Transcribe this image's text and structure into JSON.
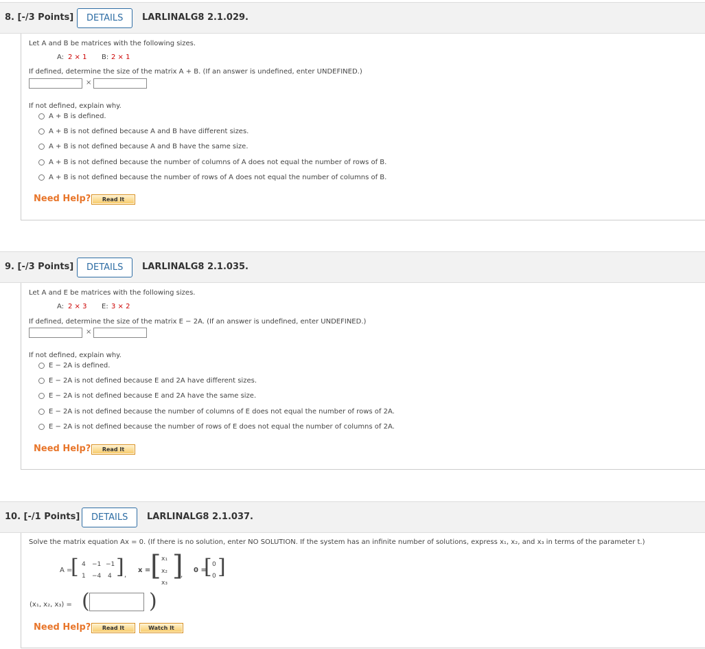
{
  "q8": {
    "points": "8.  [-/3 Points]",
    "details": "DETAILS",
    "code": "LARLINALG8 2.1.029.",
    "intro": "Let A and B be matrices with the following sizes.",
    "sizeA_label": "A:",
    "sizeA": "2 × 1",
    "sizeB_label": "B:",
    "sizeB": "2 × 1",
    "prompt": "If defined, determine the size of the matrix A + B. (If an answer is undefined, enter UNDEFINED.)",
    "times": "×",
    "explain": "If not defined, explain why.",
    "options": [
      "A + B is defined.",
      "A + B is not defined because A and B have different sizes.",
      "A + B is not defined because A and B have the same size.",
      "A + B is not defined because the number of columns of A does not equal the number of rows of B.",
      "A + B is not defined because the number of rows of A does not equal the number of columns of B."
    ],
    "help": "Need Help?",
    "read": "Read It"
  },
  "q9": {
    "points": "9.  [-/3 Points]",
    "details": "DETAILS",
    "code": "LARLINALG8 2.1.035.",
    "intro": "Let A and E be matrices with the following sizes.",
    "sizeA_label": "A:",
    "sizeA": "2 × 3",
    "sizeB_label": "E:",
    "sizeB": "3 × 2",
    "prompt": "If defined, determine the size of the matrix E − 2A. (If an answer is undefined, enter UNDEFINED.)",
    "times": "×",
    "explain": "If not defined, explain why.",
    "options": [
      "E − 2A is defined.",
      "E − 2A is not defined because E and 2A have different sizes.",
      "E − 2A is not defined because E and 2A have the same size.",
      "E − 2A is not defined because the number of columns of E does not equal the number of rows of 2A.",
      "E − 2A is not defined because the number of rows of E does not equal the number of columns of 2A."
    ],
    "help": "Need Help?",
    "read": "Read It"
  },
  "q10": {
    "points": "10.  [-/1 Points]",
    "details": "DETAILS",
    "code": "LARLINALG8 2.1.037.",
    "prompt": "Solve the matrix equation Ax = 0. (If there is no solution, enter NO SOLUTION. If the system has an infinite number of solutions, express x₁, x₂, and x₃ in terms of the parameter t.)",
    "A_label": "A =",
    "A_row1": [
      "4",
      "−1",
      "−1"
    ],
    "A_row2": [
      "1",
      "−4",
      "4"
    ],
    "x_label": "x =",
    "x_entries": [
      "x₁",
      "x₂",
      "x₃"
    ],
    "zero_label": "0 =",
    "zero_entries": [
      "0",
      "0"
    ],
    "tuple_label": "(x₁, x₂, x₃) =",
    "help": "Need Help?",
    "read": "Read It",
    "watch": "Watch It"
  }
}
